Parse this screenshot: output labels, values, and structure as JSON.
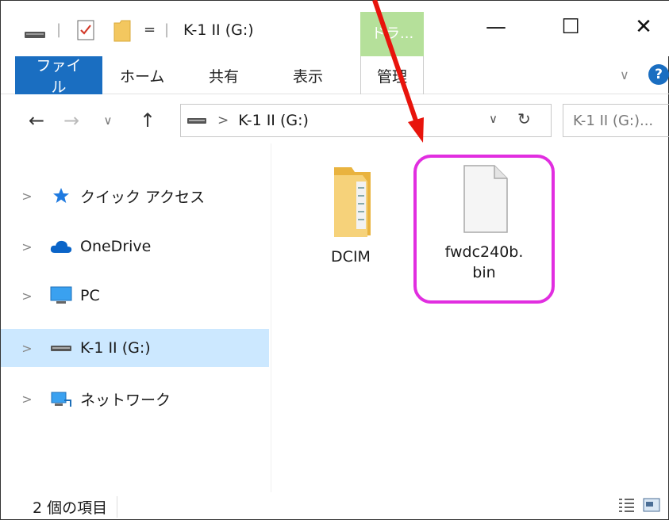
{
  "window": {
    "title": "K-1 II (G:)",
    "context_tab": "ドラ...",
    "separator": "|",
    "dropdown": "=",
    "minimize": "—",
    "maximize": "☐",
    "close": "✕"
  },
  "ribbon": {
    "tabs": [
      {
        "label": "ファイル"
      },
      {
        "label": "ホーム"
      },
      {
        "label": "共有"
      },
      {
        "label": "表示"
      },
      {
        "label": "管理"
      }
    ],
    "collapse_glyph": "∨",
    "help_glyph": "?"
  },
  "address_bar": {
    "path_separator": ">",
    "path": "K-1 II (G:)",
    "search_placeholder": "K-1 II (G:)...",
    "back_glyph": "←",
    "forward_glyph": "→",
    "recent_glyph": "∨",
    "up_glyph": "↑",
    "dropdown_glyph": "∨",
    "refresh_glyph": "↻"
  },
  "sidebar": {
    "items": [
      {
        "label": "クイック アクセス",
        "icon": "star-icon"
      },
      {
        "label": "OneDrive",
        "icon": "cloud-icon"
      },
      {
        "label": "PC",
        "icon": "monitor-icon"
      },
      {
        "label": "K-1 II (G:)",
        "icon": "drive-icon",
        "selected": true
      },
      {
        "label": "ネットワーク",
        "icon": "network-icon"
      }
    ],
    "chevron": ">"
  },
  "files": [
    {
      "name": "DCIM",
      "type": "folder"
    },
    {
      "name": "fwdc240b.bin",
      "type": "file"
    }
  ],
  "status_bar": {
    "item_count": "2 個の項目"
  },
  "colors": {
    "accent": "#1a6ec1",
    "selection": "#cce8ff",
    "context_tab": "#b5e09a",
    "highlight": "#e12ee0",
    "arrow": "#e8140c"
  }
}
